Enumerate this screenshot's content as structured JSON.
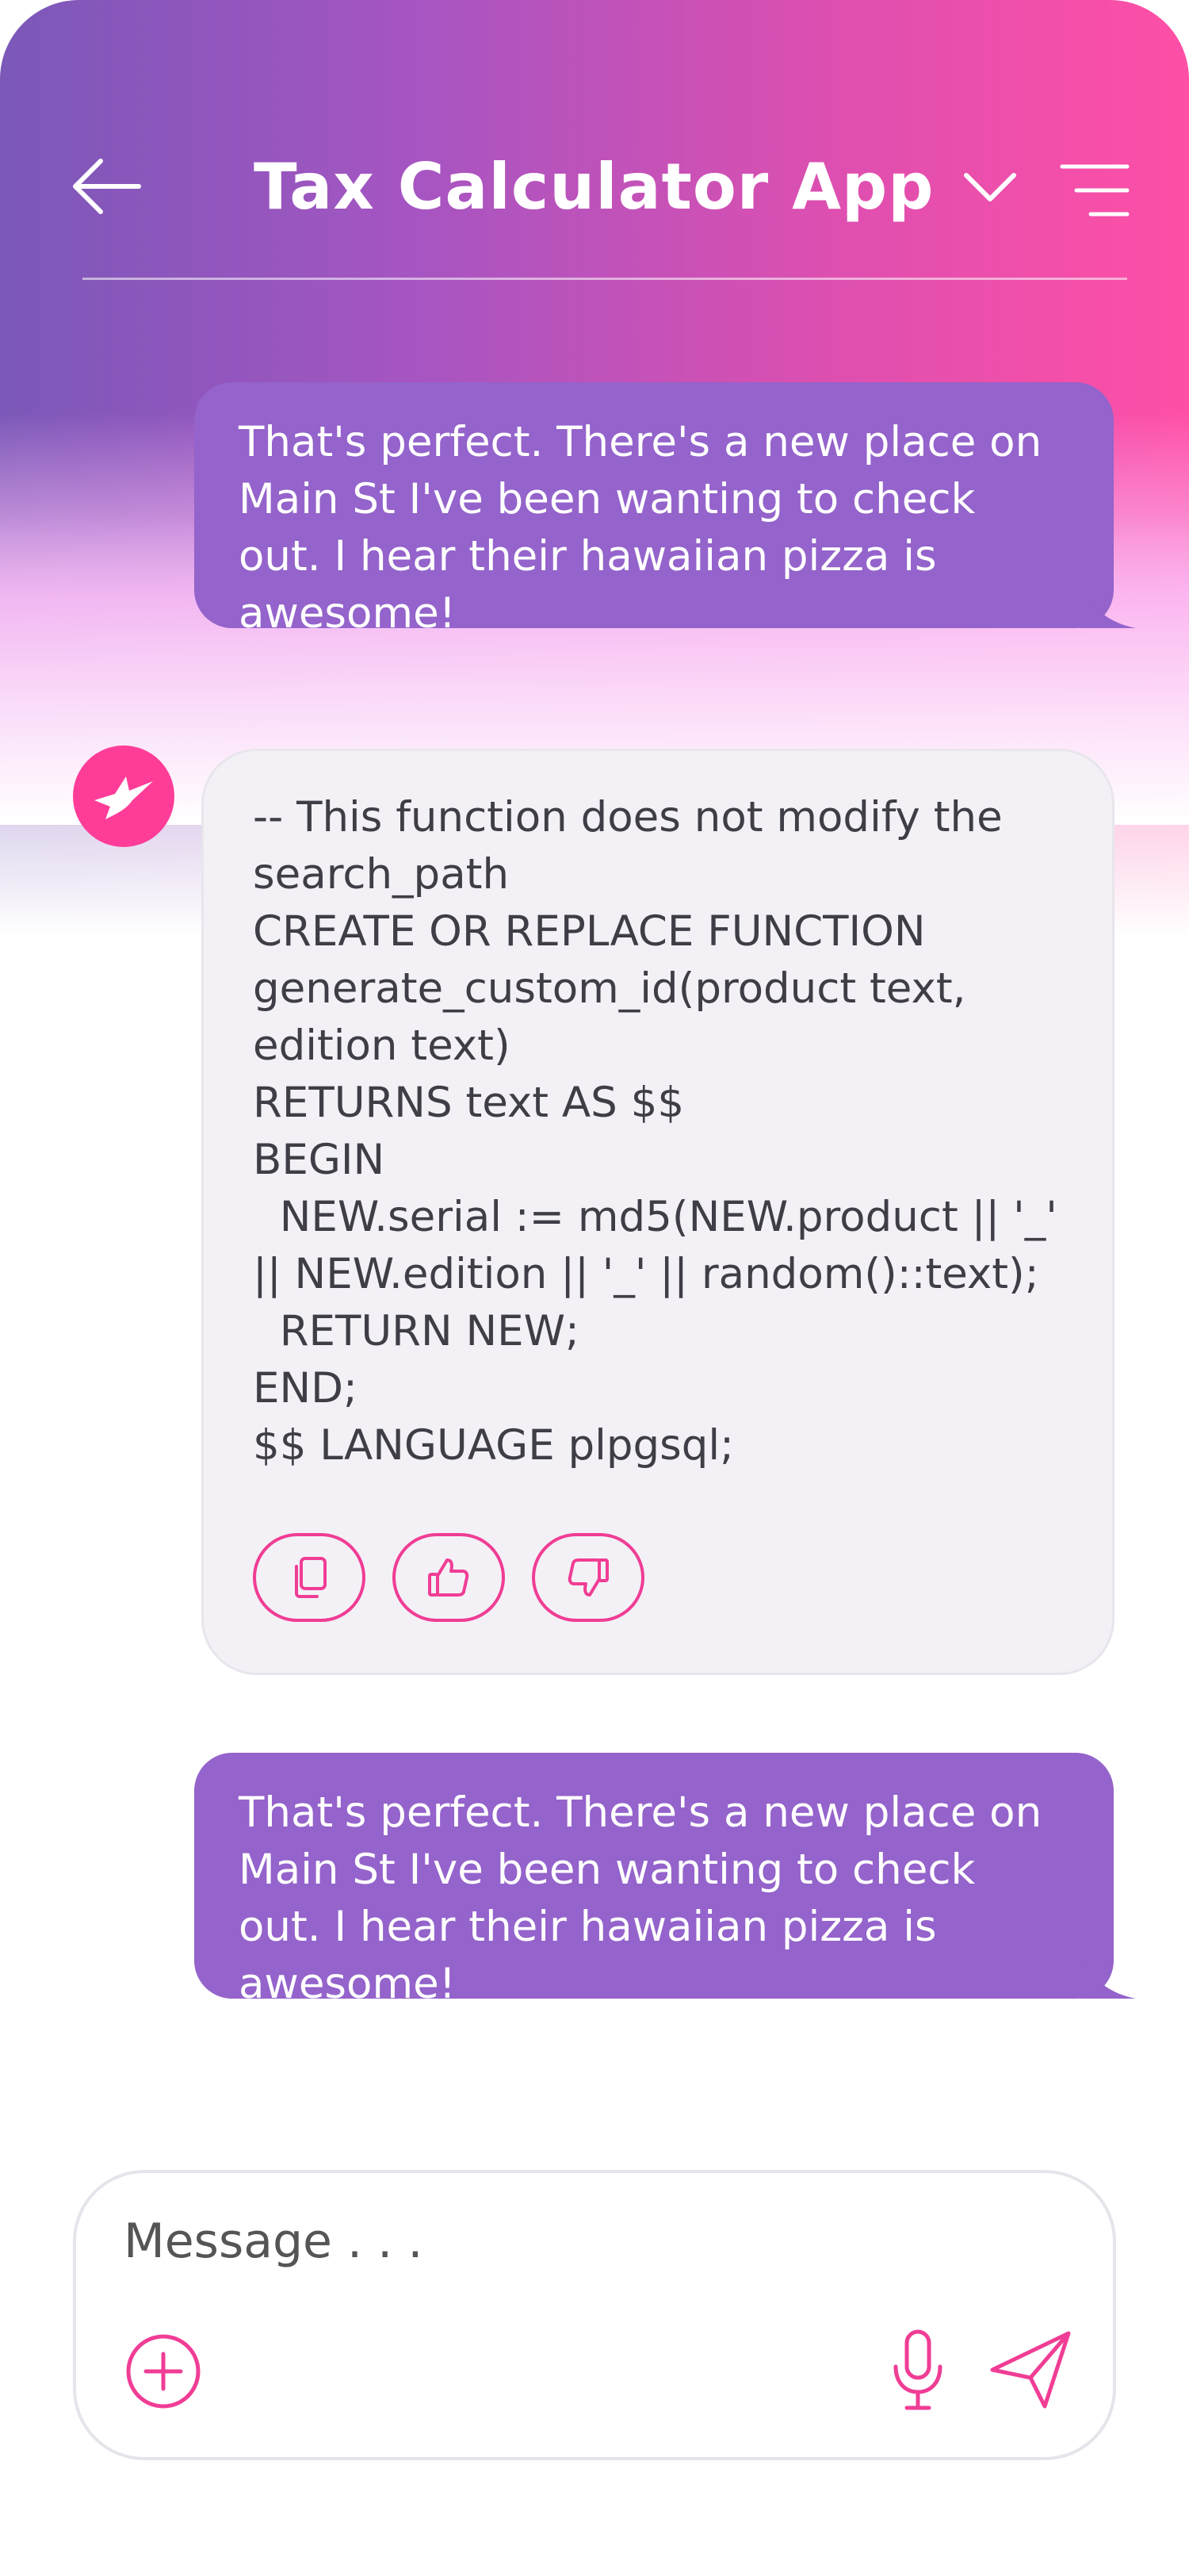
{
  "header": {
    "title": "Tax Calculator App",
    "icons": {
      "back": "arrow-left-icon",
      "title_dropdown": "chevron-down-icon",
      "menu": "menu-icon"
    }
  },
  "messages": [
    {
      "sender": "user",
      "text": "That's perfect. There's a new place on Main St I've been wanting to check out. I hear their hawaiian pizza is awesome!"
    },
    {
      "sender": "assistant",
      "avatar_icon": "hummingbird-icon",
      "text": "-- This function does not modify the search_path\nCREATE OR REPLACE FUNCTION generate_custom_id(product text, edition text)\nRETURNS text AS $$\nBEGIN\n  NEW.serial := md5(NEW.product || '_' || NEW.edition || '_' || random()::text);\n  RETURN NEW;\nEND;\n$$ LANGUAGE plpgsql;",
      "actions": [
        {
          "icon": "copy-icon"
        },
        {
          "icon": "thumbs-up-icon"
        },
        {
          "icon": "thumbs-down-icon"
        }
      ]
    },
    {
      "sender": "user",
      "text": "That's perfect. There's a new place on Main St I've been wanting to check out. I hear their hawaiian pizza is awesome!"
    }
  ],
  "composer": {
    "placeholder": "Message . . .",
    "value": "",
    "icons": {
      "attach": "plus-circle-icon",
      "mic": "microphone-icon",
      "send": "send-icon"
    }
  },
  "colors": {
    "accent": "#F03D95",
    "user_bubble": "#9463CB",
    "bot_bubble": "#F3F1F6",
    "text_dark": "#3F3D45"
  }
}
